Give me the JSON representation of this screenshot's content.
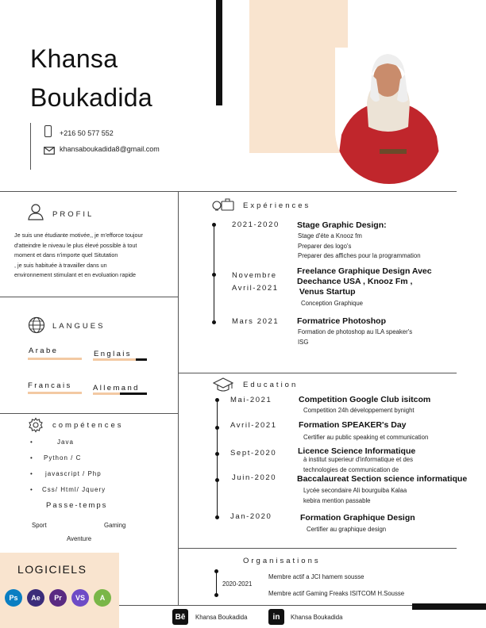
{
  "header": {
    "first_name": "Khansa",
    "last_name": "Boukadida",
    "phone": "+216 50 577 552",
    "email": "khansaboukadida8@gmail.com"
  },
  "profil": {
    "title": "PROFIL",
    "lines": [
      "Je suis une étudiante motivée,, je m'efforce toujour",
      "d'atteindre le niveau le plus élevé possible à tout",
      "moment et dans n'importe quel Situtation",
      " , je suis habituée à travailler dans un",
      "environnement stimulant et en evoluation rapide"
    ]
  },
  "langues": {
    "title": "LANGUES",
    "items": [
      {
        "name": "Arabe",
        "level": 1.0
      },
      {
        "name": "Englais",
        "level": 0.8
      },
      {
        "name": "Francais",
        "level": 1.0
      },
      {
        "name": "Allemand",
        "level": 0.5
      }
    ]
  },
  "competences": {
    "title": "compétences",
    "items": [
      "Java",
      "Python / C",
      "javascript / Php",
      "Css/ Html/ Jquery"
    ],
    "passe_temps_title": "Passe-temps",
    "hobbies": [
      "Sport",
      "Gaming",
      "Aventure"
    ]
  },
  "logiciels": {
    "title": "LOGICIELS",
    "apps": [
      {
        "label": "Ps",
        "icon": "photoshop-icon",
        "color": "#0a7ec2"
      },
      {
        "label": "Ae",
        "icon": "after-effects-icon",
        "color": "#3b2c7a"
      },
      {
        "label": "Pr",
        "icon": "premiere-icon",
        "color": "#5a2a82"
      },
      {
        "label": "VS",
        "icon": "visual-studio-icon",
        "color": "#6e4bc6"
      },
      {
        "label": "A",
        "icon": "android-studio-icon",
        "color": "#7ab648"
      }
    ]
  },
  "experiences": {
    "title": "Expériences",
    "items": [
      {
        "date": "2021-2020",
        "title": "Stage Graphic Design:",
        "desc": [
          "Stage d'éte a Knooz fm",
          "Preparer des logo's",
          "Preparer des affiches pour la programmation"
        ]
      },
      {
        "date": "Novembre\nAvril-2021",
        "title": "Freelance Graphique Design Avec\nDeechance USA , Knooz Fm ,\n Venus Startup",
        "desc": [
          "Conception Graphique"
        ]
      },
      {
        "date": "Mars 2021",
        "title": "Formatrice Photoshop",
        "desc": [
          "Formation de photoshop au ILA speaker's",
          "ISG"
        ]
      }
    ]
  },
  "education": {
    "title": "Education",
    "items": [
      {
        "date": "Mai-2021",
        "title": "Competition Google Club isitcom",
        "desc": [
          "Competition 24h développement bynight"
        ]
      },
      {
        "date": "Avril-2021",
        "title": "Formation SPEAKER's Day",
        "desc": [
          "Certifier au public speaking et communication"
        ]
      },
      {
        "date": "Sept-2020",
        "title": "Licence Science Informatique",
        "desc": [
          "à institut superieur d'informatique et des",
          "technologies de communication de"
        ]
      },
      {
        "date": "Juin-2020",
        "title": "Baccalaureat Section science informatique",
        "desc": [
          "Lycée secondaire Ali bourguiba Kalaa",
          "kebira  mention passable"
        ]
      },
      {
        "date": "Jan-2020",
        "title": "Formation Graphique Design",
        "desc": [
          "Certifier au graphique design"
        ]
      }
    ]
  },
  "organisations": {
    "title": "Organisations",
    "date": "2020-2021",
    "items": [
      "Membre actif a JCI hamem sousse",
      "Membre actif Gaming Freaks ISITCOM H.Sousse"
    ]
  },
  "footer": {
    "behance_label": "Khansa Boukadida",
    "linkedin_label": "Khansa Boukadida"
  },
  "colors": {
    "accent_peach": "#f9e4cf",
    "bar_peach": "#f3c9a3",
    "profile_red": "#c0262c"
  }
}
